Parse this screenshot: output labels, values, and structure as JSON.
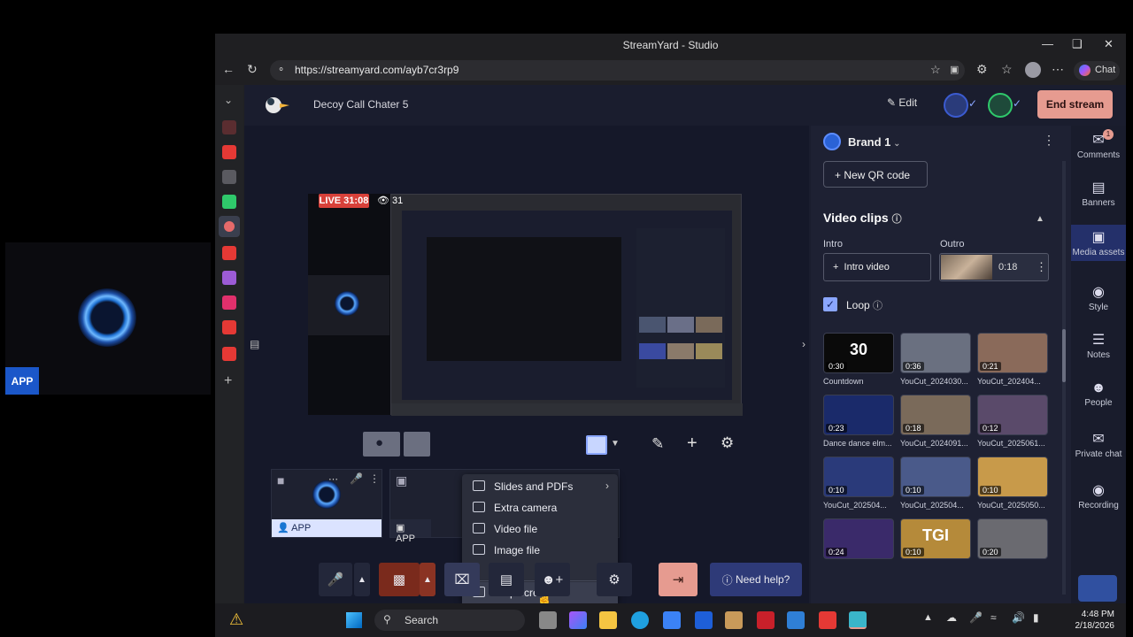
{
  "guest": {
    "tag": "APP"
  },
  "browser": {
    "title": "StreamYard - Studio",
    "url": "https://streamyard.com/ayb7cr3rp9",
    "chat_label": "Chat"
  },
  "studio": {
    "show_title": "Decoy Call Chater 5",
    "edit_label": "Edit",
    "end_label": "End stream",
    "live_label": "LIVE 31:08",
    "viewers": "31"
  },
  "camera_tiles": [
    {
      "name": "APP"
    },
    {
      "name": "APP"
    }
  ],
  "share_menu": {
    "items": [
      {
        "label": "Slides and PDFs"
      },
      {
        "label": "Extra camera"
      },
      {
        "label": "Video file"
      },
      {
        "label": "Image file"
      },
      {
        "label": "Stop screen"
      }
    ]
  },
  "controls": {
    "help_label": "Need help?"
  },
  "panel": {
    "brand": "Brand 1",
    "qr_label": "New QR code",
    "clips_title": "Video clips",
    "intro_label": "Intro",
    "outro_label": "Outro",
    "intro_button": "Intro video",
    "outro_duration": "0:18",
    "loop_label": "Loop",
    "clips": [
      {
        "name": "Countdown",
        "duration": "0:30",
        "overlay": "30"
      },
      {
        "name": "YouCut_2024030...",
        "duration": "0:36"
      },
      {
        "name": "YouCut_202404...",
        "duration": "0:21"
      },
      {
        "name": "Dance dance elm...",
        "duration": "0:23"
      },
      {
        "name": "YouCut_2024091...",
        "duration": "0:18"
      },
      {
        "name": "YouCut_2025061...",
        "duration": "0:12"
      },
      {
        "name": "YouCut_202504...",
        "duration": "0:10"
      },
      {
        "name": "YouCut_202504...",
        "duration": "0:10"
      },
      {
        "name": "YouCut_2025050...",
        "duration": "0:10"
      },
      {
        "name": "",
        "duration": "0:24"
      },
      {
        "name": "",
        "duration": "0:10",
        "overlay": "TGI"
      },
      {
        "name": "",
        "duration": "0:20"
      }
    ]
  },
  "rail": [
    {
      "label": "Comments",
      "icon": "comments-icon",
      "badge": "1"
    },
    {
      "label": "Banners",
      "icon": "banners-icon"
    },
    {
      "label": "Media assets",
      "icon": "media-icon"
    },
    {
      "label": "Style",
      "icon": "palette-icon"
    },
    {
      "label": "Notes",
      "icon": "notes-icon"
    },
    {
      "label": "People",
      "icon": "people-icon"
    },
    {
      "label": "Private chat",
      "icon": "chat-icon"
    },
    {
      "label": "Recording",
      "icon": "record-icon"
    }
  ],
  "taskbar": {
    "search": "Search",
    "time": "4:48 PM",
    "date": "2/18/2026"
  },
  "colors": {
    "end_stream": "#e69b90",
    "live": "#d8413a",
    "accent": "#1b57c9"
  }
}
